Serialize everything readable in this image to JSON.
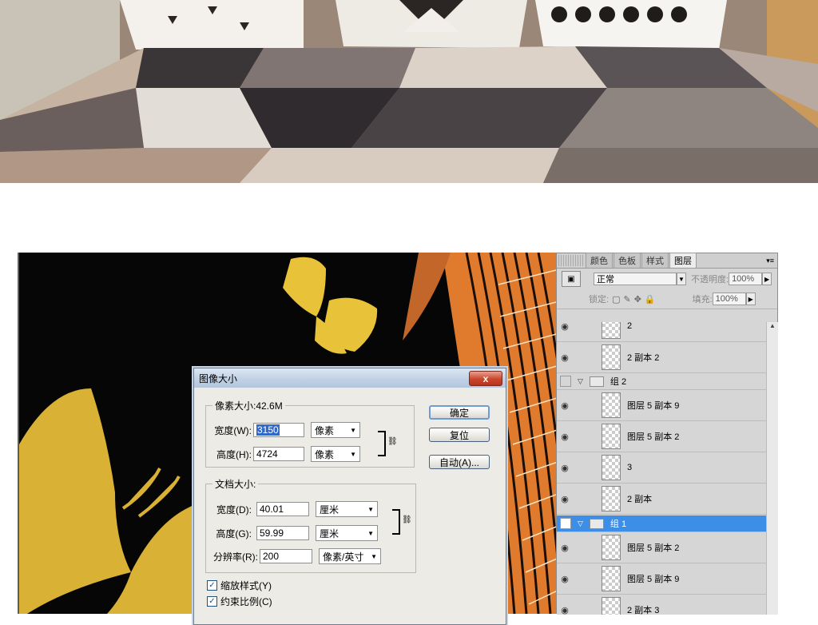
{
  "dialog": {
    "title": "图像大小",
    "close": "x",
    "pixel_size_label": "像素大小:42.6M",
    "width_label": "宽度(W):",
    "width_value": "3150",
    "width_unit": "像素",
    "height_label": "高度(H):",
    "height_value": "4724",
    "height_unit": "像素",
    "doc_size_label": "文档大小:",
    "doc_width_label": "宽度(D):",
    "doc_width_value": "40.01",
    "doc_width_unit": "厘米",
    "doc_height_label": "高度(G):",
    "doc_height_value": "59.99",
    "doc_height_unit": "厘米",
    "resolution_label": "分辨率(R):",
    "resolution_value": "200",
    "resolution_unit": "像素/英寸",
    "ok": "确定",
    "reset": "复位",
    "auto": "自动(A)...",
    "scale_styles": "缩放样式(Y)",
    "constrain": "约束比例(C)"
  },
  "panel": {
    "tabs": [
      "颜色",
      "色板",
      "样式",
      "图层"
    ],
    "active_tab": "图层",
    "blend_mode": "正常",
    "opacity_label": "不透明度:",
    "opacity_value": "100%",
    "lock_label": "锁定:",
    "fill_label": "填充:",
    "fill_value": "100%",
    "layers": [
      {
        "name": "2",
        "type": "layer",
        "visible": true
      },
      {
        "name": "2 副本 2",
        "type": "layer",
        "visible": true
      },
      {
        "name": "组 2",
        "type": "group",
        "visible": false
      },
      {
        "name": "图层 5 副本 9",
        "type": "layer",
        "visible": true
      },
      {
        "name": "图层 5 副本 2",
        "type": "layer",
        "visible": true
      },
      {
        "name": "3",
        "type": "layer",
        "visible": true
      },
      {
        "name": "2 副本",
        "type": "layer",
        "visible": true
      },
      {
        "name": "组 1",
        "type": "group",
        "visible": false,
        "selected": true
      },
      {
        "name": "图层 5 副本 2",
        "type": "layer",
        "visible": true
      },
      {
        "name": "图层 5 副本 9",
        "type": "layer",
        "visible": true
      },
      {
        "name": "2 副本 3",
        "type": "layer",
        "visible": true
      }
    ]
  },
  "colors": {
    "selected_layer": "#3d8ee6",
    "dialog_bg": "#ecebe6",
    "butterfly_gold": "#e8c33a"
  }
}
